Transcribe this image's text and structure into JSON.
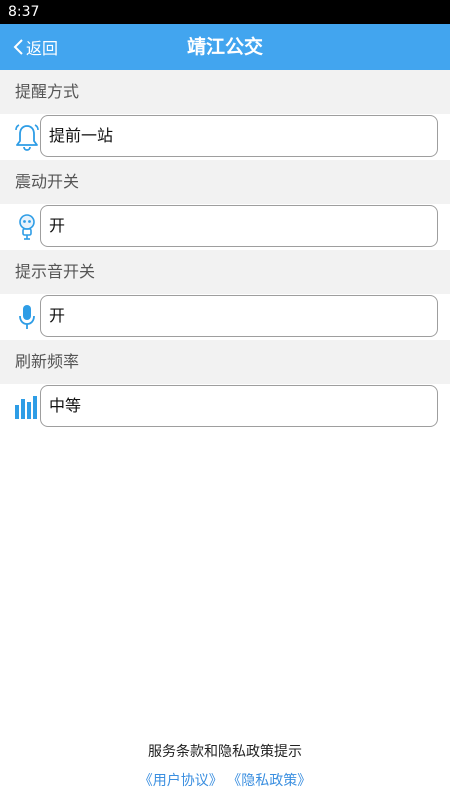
{
  "statusbar": {
    "time": "8:37"
  },
  "header": {
    "back_label": "返回",
    "title": "靖江公交"
  },
  "sections": [
    {
      "label": "提醒方式",
      "value": "提前一站",
      "icon": "bell-icon"
    },
    {
      "label": "震动开关",
      "value": "开",
      "icon": "robot-icon"
    },
    {
      "label": "提示音开关",
      "value": "开",
      "icon": "microphone-icon"
    },
    {
      "label": "刷新频率",
      "value": "中等",
      "icon": "signal-bars-icon"
    }
  ],
  "footer": {
    "title": "服务条款和隐私政策提示",
    "user_agreement": "《用户协议》",
    "privacy_policy": "《隐私政策》"
  },
  "colors": {
    "accent": "#42a5ef",
    "icon": "#2e9de6"
  }
}
